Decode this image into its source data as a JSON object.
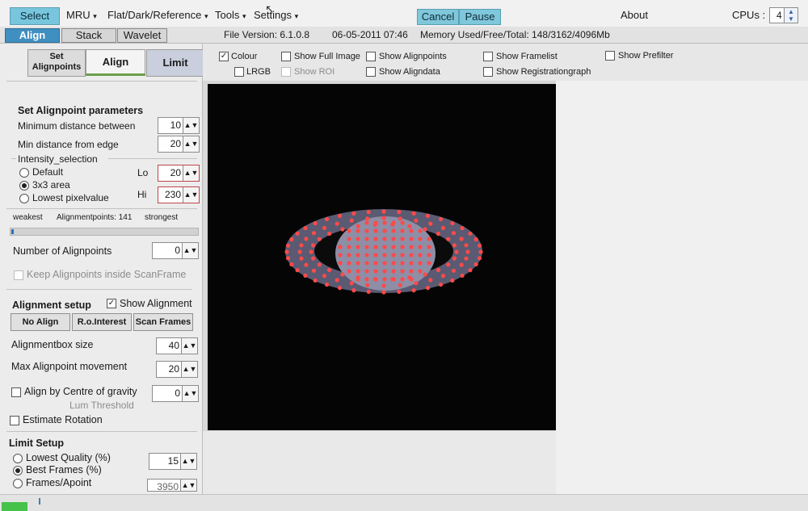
{
  "menubar": {
    "select": "Select",
    "mru": "MRU",
    "flat": "Flat/Dark/Reference",
    "tools": "Tools",
    "settings": "Settings",
    "cancel": "Cancel",
    "pause": "Pause",
    "about": "About",
    "cpus_label": "CPUs :",
    "cpus_value": "4"
  },
  "tabs": [
    "Align",
    "Stack",
    "Wavelet"
  ],
  "info": {
    "file_version": "File Version: 6.1.0.8",
    "datetime": "06-05-2011 07:46",
    "memory": "Memory Used/Free/Total: 148/3162/4096Mb"
  },
  "subtabs": {
    "set_alignpoints_line1": "Set",
    "set_alignpoints_line2": "Alignpoints",
    "align": "Align",
    "limit": "Limit"
  },
  "options": {
    "colour": "Colour",
    "lrgb": "LRGB",
    "show_full_image": "Show Full Image",
    "show_roi": "Show ROI",
    "show_alignpoints": "Show Alignpoints",
    "show_aligndata": "Show Aligndata",
    "show_framelist": "Show Framelist",
    "show_registrationgraph": "Show Registrationgraph",
    "show_prefilter": "Show Prefilter"
  },
  "alignpoint": {
    "heading": "Set Alignpoint parameters",
    "min_distance_label": "Minimum distance between",
    "min_distance_value": "10",
    "min_edge_label": "Min distance from edge",
    "min_edge_value": "20",
    "intensity_label": "Intensity_selection",
    "default_label": "Default",
    "area_label": "3x3 area",
    "lowest_label": "Lowest pixelvalue",
    "lo_label": "Lo",
    "lo_value": "20",
    "hi_label": "Hi",
    "hi_value": "230",
    "weakest": "weakest",
    "points_label": "Alignmentpoints: 141",
    "strongest": "strongest",
    "number_label": "Number of Alignpoints",
    "number_value": "0",
    "keep_inside": "Keep Alignpoints inside ScanFrame"
  },
  "alignment": {
    "heading": "Alignment setup",
    "show_alignment": "Show Alignment",
    "no_align": "No Align",
    "roi": "R.o.Interest",
    "scan_frames": "Scan Frames",
    "box_size_label": "Alignmentbox size",
    "box_size_value": "40",
    "max_move_label": "Max Alignpoint movement",
    "max_move_value": "20",
    "centre_label": "Align by Centre of gravity",
    "centre_value": "0",
    "lum_threshold": "Lum  Threshold",
    "estimate_rotation": "Estimate Rotation"
  },
  "limit": {
    "heading": "Limit Setup",
    "lowest_quality": "Lowest Quality (%)",
    "best_frames": "Best Frames (%)",
    "best_frames_value": "15",
    "frames_apoint": "Frames/Apoint",
    "frames_apoint_value": "3950"
  },
  "progress": {
    "alignpoint_slider": 0.01
  },
  "colors": {
    "accent_blue": "#7fc7da",
    "tab_active": "#3f8fc0",
    "alignpoint_red": "#ff4a4a",
    "planet": "#8e8ea6"
  }
}
